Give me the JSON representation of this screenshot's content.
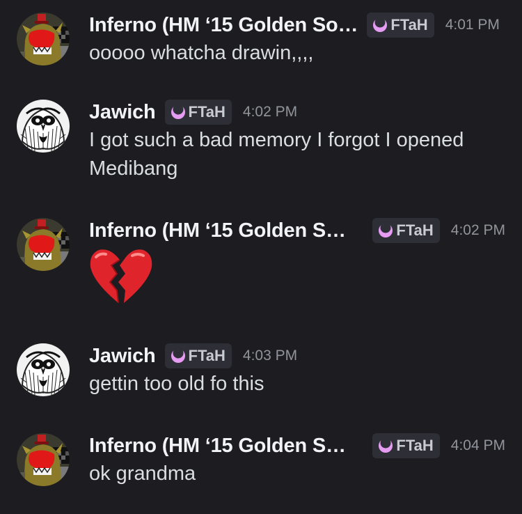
{
  "messages": [
    {
      "author": "Inferno (HM ‘15 Golden So…",
      "tag": "FTaH",
      "time": "4:01 PM",
      "text": "ooooo whatcha drawin,,,,",
      "avatar": "inferno-avatar"
    },
    {
      "author": "Jawich",
      "tag": "FTaH",
      "time": "4:02 PM",
      "text": "I got such a bad memory I forgot I opened Medibang",
      "avatar": "jawich-avatar"
    },
    {
      "author": "Inferno (HM ‘15 Golden S…",
      "tag": "FTaH",
      "time": "4:02 PM",
      "emoji": "broken-heart",
      "avatar": "inferno-avatar"
    },
    {
      "author": "Jawich",
      "tag": "FTaH",
      "time": "4:03 PM",
      "text": "gettin too old fo this",
      "avatar": "jawich-avatar"
    },
    {
      "author": "Inferno (HM ‘15 Golden S…",
      "tag": "FTaH",
      "time": "4:04 PM",
      "text": "ok grandma",
      "avatar": "inferno-avatar"
    }
  ],
  "colors": {
    "background": "#1c1c21",
    "username": "#f2f3f5",
    "message_text": "#dbdee1",
    "timestamp": "#92949c",
    "tag_background": "#2e2f36",
    "tag_icon": "#e59cf2"
  }
}
